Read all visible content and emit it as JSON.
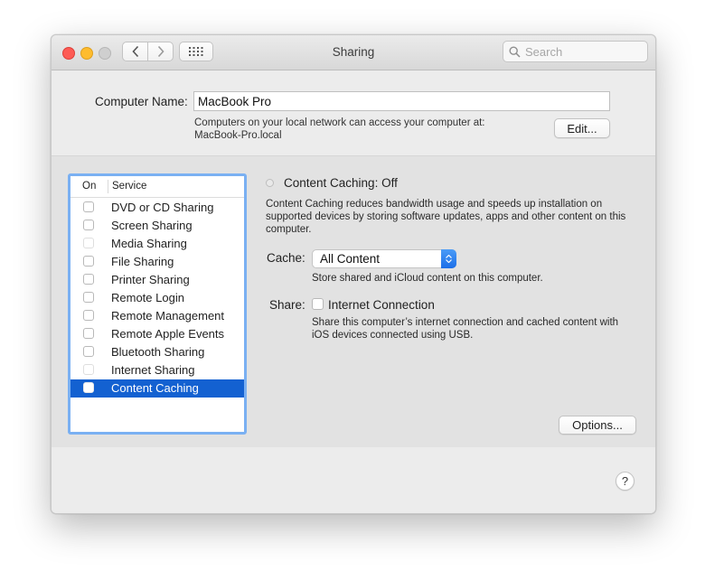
{
  "window": {
    "title": "Sharing"
  },
  "toolbar": {
    "search_placeholder": "Search",
    "icons": {
      "back": "chevron-left-icon",
      "forward": "chevron-right-icon",
      "show_all": "grid-icon",
      "search": "search-icon"
    }
  },
  "computer": {
    "name_label": "Computer Name:",
    "name_value": "MacBook Pro",
    "access_line1": "Computers on your local network can access your computer at:",
    "access_line2": "MacBook-Pro.local",
    "edit_label": "Edit..."
  },
  "services": {
    "header_on": "On",
    "header_service": "Service",
    "items": [
      {
        "label": "DVD or CD Sharing",
        "checked": false,
        "enabled": true
      },
      {
        "label": "Screen Sharing",
        "checked": false,
        "enabled": true
      },
      {
        "label": "Media Sharing",
        "checked": false,
        "enabled": false
      },
      {
        "label": "File Sharing",
        "checked": false,
        "enabled": true
      },
      {
        "label": "Printer Sharing",
        "checked": false,
        "enabled": true
      },
      {
        "label": "Remote Login",
        "checked": false,
        "enabled": true
      },
      {
        "label": "Remote Management",
        "checked": false,
        "enabled": true
      },
      {
        "label": "Remote Apple Events",
        "checked": false,
        "enabled": true
      },
      {
        "label": "Bluetooth Sharing",
        "checked": false,
        "enabled": true
      },
      {
        "label": "Internet Sharing",
        "checked": false,
        "enabled": false
      },
      {
        "label": "Content Caching",
        "checked": false,
        "enabled": true,
        "selected": true
      }
    ]
  },
  "detail": {
    "status": "Content Caching: Off",
    "description": "Content Caching reduces bandwidth usage and speeds up installation on supported devices by storing software updates, apps and other content on this computer.",
    "cache_label": "Cache:",
    "cache_value": "All Content",
    "cache_note": "Store shared and iCloud content on this computer.",
    "share_label": "Share:",
    "share_option": "Internet Connection",
    "share_checked": false,
    "share_note": "Share this computer’s internet connection and cached content with iOS devices connected using USB.",
    "options_label": "Options..."
  },
  "help": {
    "label": "?"
  },
  "colors": {
    "selection": "#1361d1",
    "focus_ring": "#7ab0f2",
    "close": "#fd5b55",
    "minimize": "#febc2e"
  }
}
